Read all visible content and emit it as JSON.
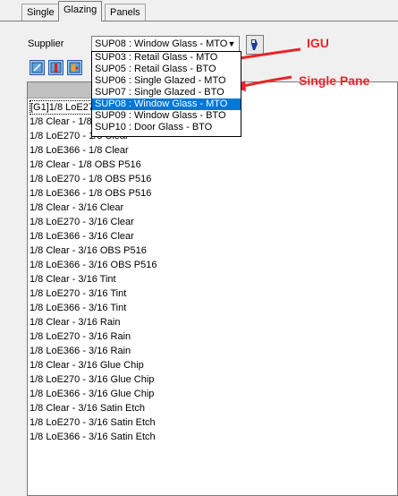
{
  "tabs": [
    "Single",
    "Glazing",
    "Panels"
  ],
  "supplier": {
    "label": "Supplier",
    "value": "SUP08 : Window Glass - MTO",
    "options": [
      "SUP03 : Retail Glass - MTO",
      "SUP05 : Retail Glass - BTO",
      "SUP06 : Single Glazed - MTO",
      "SUP07 : Single Glazed - BTO",
      "SUP08 : Window Glass - MTO",
      "SUP09 : Window Glass - BTO",
      "SUP10 : Door Glass - BTO"
    ]
  },
  "annotations": {
    "igu": "IGU",
    "single_pane": "Single Pane",
    "color": "#e8262b"
  },
  "list": {
    "items": [
      "[G1]1/8 LoE270",
      "1/8 Clear - 1/8",
      "1/8 LoE270 - 1/8 Clear",
      "1/8 LoE366 - 1/8 Clear",
      "1/8 Clear - 1/8 OBS P516",
      "1/8 LoE270 - 1/8 OBS P516",
      "1/8 LoE366 - 1/8 OBS P516",
      "1/8 Clear - 3/16 Clear",
      "1/8 LoE270 - 3/16 Clear",
      "1/8 LoE366 - 3/16 Clear",
      "1/8 Clear - 3/16 OBS P516",
      "1/8 LoE366 - 3/16 OBS P516",
      "1/8 Clear - 3/16 Tint",
      "1/8 LoE270 - 3/16 Tint",
      "1/8 LoE366 - 3/16 Tint",
      "1/8 Clear - 3/16 Rain",
      "1/8 LoE270 - 3/16 Rain",
      "1/8 LoE366 - 3/16 Rain",
      "1/8 Clear - 3/16 Glue Chip",
      "1/8 LoE270 - 3/16 Glue Chip",
      "1/8 LoE366 - 3/16 Glue Chip",
      "1/8 Clear - 3/16 Satin Etch",
      "1/8 LoE270 - 3/16 Satin Etch",
      "1/8 LoE366 - 3/16 Satin Etch"
    ]
  }
}
